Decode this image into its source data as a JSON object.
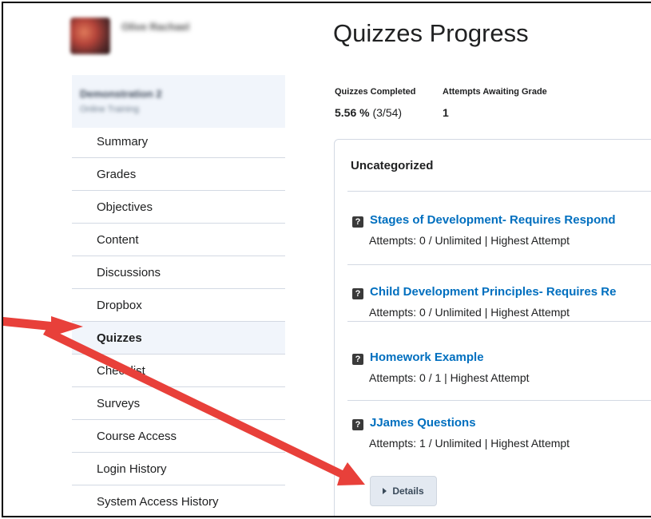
{
  "user": {
    "name": "Olive Rachael"
  },
  "course": {
    "name": "Demonstration 2",
    "subtitle": "Online Training"
  },
  "sidebar": {
    "items": [
      {
        "label": "Summary"
      },
      {
        "label": "Grades"
      },
      {
        "label": "Objectives"
      },
      {
        "label": "Content"
      },
      {
        "label": "Discussions"
      },
      {
        "label": "Dropbox"
      },
      {
        "label": "Quizzes",
        "active": true
      },
      {
        "label": "Checklist"
      },
      {
        "label": "Surveys"
      },
      {
        "label": "Course Access"
      },
      {
        "label": "Login History"
      },
      {
        "label": "System Access History"
      }
    ]
  },
  "main": {
    "title": "Quizzes Progress",
    "stats": {
      "completed_label": "Quizzes Completed",
      "completed_percent": "5.56 %",
      "completed_count": "(3/54)",
      "awaiting_label": "Attempts Awaiting Grade",
      "awaiting_value": "1"
    },
    "panel": {
      "category": "Uncategorized",
      "quizzes": [
        {
          "title": "Stages of Development- Requires Respond",
          "meta": "Attempts: 0 / Unlimited | Highest Attempt"
        },
        {
          "title": "Child Development Principles- Requires Re",
          "meta": "Attempts: 0 / Unlimited | Highest Attempt"
        },
        {
          "title": "Homework Example",
          "meta": "Attempts: 0 / 1 | Highest Attempt"
        },
        {
          "title": "JJames Questions",
          "meta": "Attempts: 1 / Unlimited | Highest Attempt"
        }
      ],
      "details_label": "Details"
    }
  },
  "colors": {
    "link": "#006fbf",
    "annotation_arrow": "#e8403a",
    "active_bg": "#f1f5fb"
  }
}
